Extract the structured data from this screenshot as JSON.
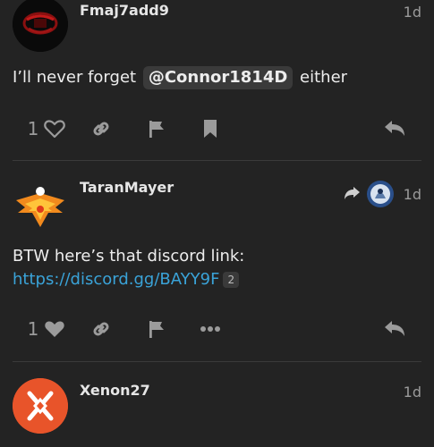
{
  "posts": [
    {
      "username": "Fmaj7add9",
      "date": "1d",
      "text_before": "I’ll never forget",
      "mention": "@Connor1814D",
      "text_after": "either",
      "like_count": "1",
      "liked": false
    },
    {
      "username": "TaranMayer",
      "date": "1d",
      "text_line1": "BTW here’s that discord link:",
      "link": "https://discord.gg/BAYY9F",
      "link_clicks": "2",
      "like_count": "1",
      "liked": true
    },
    {
      "username": "Xenon27",
      "date": "1d"
    }
  ],
  "colors": {
    "background": "#232323",
    "link": "#3aa3d8",
    "icon": "#9b9b9b",
    "xenon_avatar": "#e8542a"
  }
}
